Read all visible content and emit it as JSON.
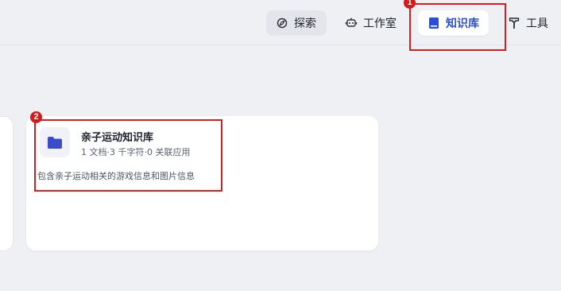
{
  "nav": {
    "items": [
      {
        "label": "探索",
        "icon": "compass-icon"
      },
      {
        "label": "工作室",
        "icon": "robot-icon"
      },
      {
        "label": "知识库",
        "icon": "book-icon",
        "active": true
      },
      {
        "label": "工具",
        "icon": "hammer-icon"
      }
    ]
  },
  "annotations": {
    "marker1": "1",
    "marker2": "2"
  },
  "knowledge_card": {
    "title": "亲子运动知识库",
    "meta": "1 文档·3 千字符·0 关联应用",
    "description": "包含亲子运动相关的游戏信息和图片信息",
    "icon": "folder-icon"
  },
  "colors": {
    "accent": "#2a4fd6",
    "folder": "#3b4cca",
    "highlight_red": "#d21f1f",
    "background": "#eef0f4"
  }
}
